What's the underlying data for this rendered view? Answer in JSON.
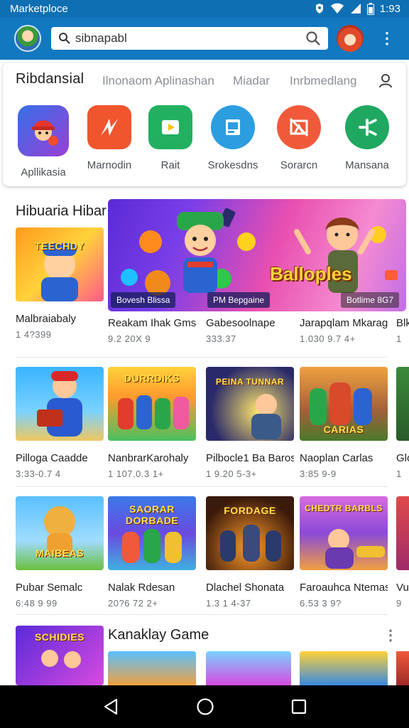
{
  "status_bar": {
    "app_name": "Marketploce",
    "time": "1:93"
  },
  "search": {
    "query": "sibnapabl"
  },
  "category_tabs": [
    {
      "label": "Ribdansial"
    },
    {
      "label": "Ilnonaom Aplinashan"
    },
    {
      "label": "Miadar"
    },
    {
      "label": "Inrbmedlang"
    }
  ],
  "apps": [
    {
      "label": "Apllikasia",
      "icon": "game-character-icon",
      "color": "#2f6fdc"
    },
    {
      "label": "Marnodin",
      "icon": "lightning-bolt-icon",
      "color": "#f0552d"
    },
    {
      "label": "Rait",
      "icon": "play-card-icon",
      "color": "#22b060"
    },
    {
      "label": "Srokesdns",
      "icon": "tablet-icon",
      "color": "#2c9ee0"
    },
    {
      "label": "Sorarcn",
      "icon": "crossed-box-icon",
      "color": "#f05a3a"
    },
    {
      "label": "Mansana",
      "icon": "plus-star-icon",
      "color": "#1fa860"
    }
  ],
  "section1": {
    "title": "Hibuaria Hibar"
  },
  "banner": {
    "title": "Balloples",
    "chip_left": "Bovesh Blissa",
    "chip_mid": "PM Bepgaine",
    "corner": "Botlime 8G7"
  },
  "row1": [
    {
      "title": "Malbraiabaly",
      "sub": "1 4?399",
      "thumb_text": "TEECHDY"
    },
    {
      "title": "Reakam Ihak Gms.",
      "sub": "9.2 20X 9"
    },
    {
      "title": "Gabesoolnape",
      "sub": "333.37"
    },
    {
      "title": "Jarapqlam Mkarag",
      "sub": "1.030 9.7 4+"
    },
    {
      "title": "Blk",
      "sub": "1"
    }
  ],
  "row2": [
    {
      "title": "Pilloga Caadde",
      "sub": "3:33-0.7 4",
      "thumb_text": ""
    },
    {
      "title": "NanbrarKarohaly",
      "sub": "1 107.0.3 1+",
      "thumb_text": "DURRDIKS"
    },
    {
      "title": "Pilbocle1 Ba Baros",
      "sub": "1 9.20 5-3+",
      "thumb_text": "PEINA TUNNAR"
    },
    {
      "title": "Naoplan Carlas",
      "sub": "3:85 9-9",
      "thumb_text": "CARIAS"
    },
    {
      "title": "Glo",
      "sub": "1"
    }
  ],
  "row3": [
    {
      "title": "Pubar Semalc",
      "sub": "6:48 9 99",
      "thumb_text": "MAIBEAS"
    },
    {
      "title": "Nalak Rdesan",
      "sub": "20?6 72 2+",
      "thumb_text": "SAORAR DORBADE"
    },
    {
      "title": "Dlachel Shonata",
      "sub": "1.3 1 4-37",
      "thumb_text": "FORDAGE"
    },
    {
      "title": "Faroauhca Ntemas",
      "sub": "6.53 3 9?",
      "thumb_text": "CHEDTR BARBLS"
    },
    {
      "title": "Vu",
      "sub": "9"
    }
  ],
  "section2": {
    "title": "Kanaklay Game",
    "card_text": "SCHIDIES"
  }
}
